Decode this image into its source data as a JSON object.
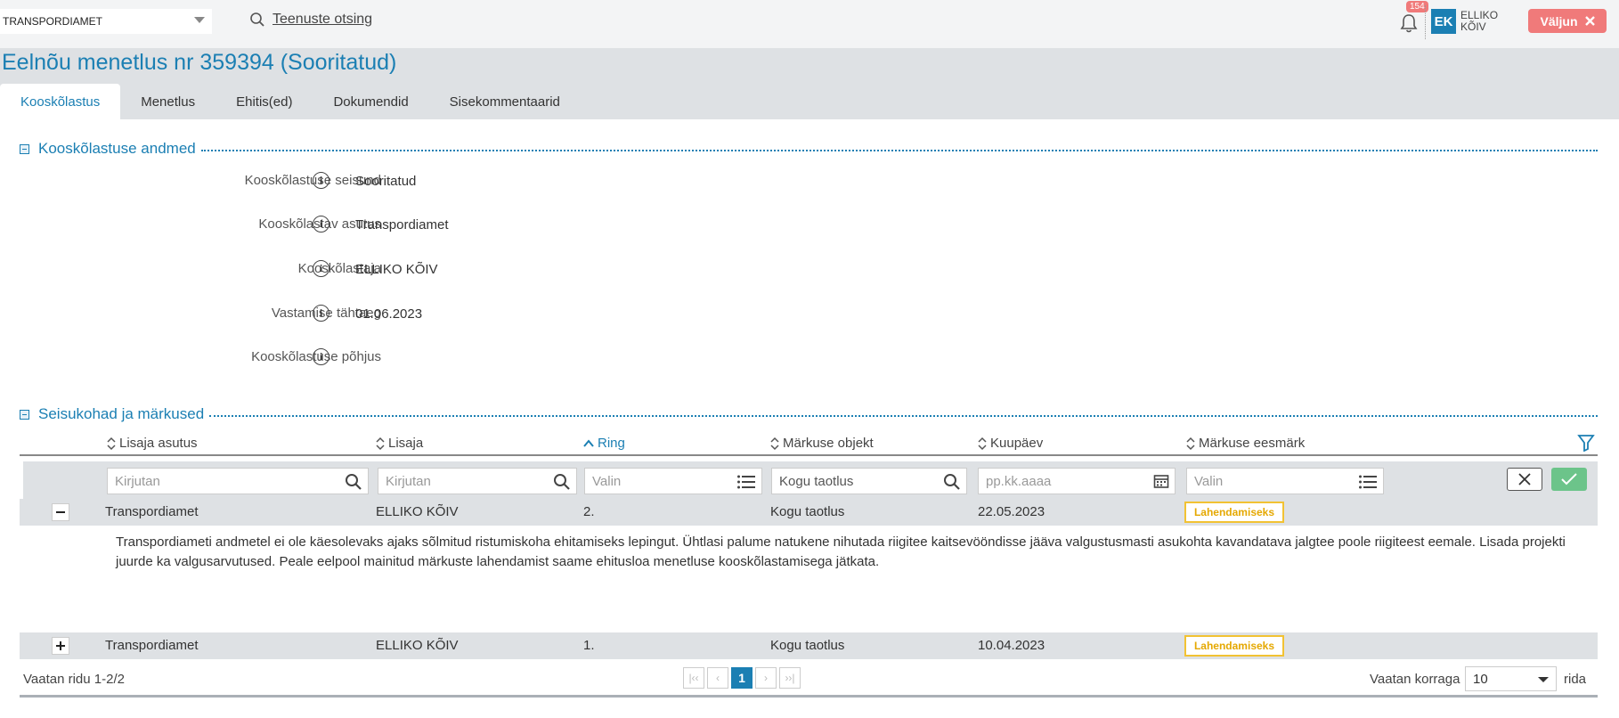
{
  "header": {
    "org": "TRANSPORDIAMET",
    "search_link": "Teenuste otsing",
    "notifications": "154",
    "avatar_initials": "EK",
    "user_first": "ELLIKO",
    "user_last": "KÕIV",
    "logout": "Väljun"
  },
  "page": {
    "title": "Eelnõu menetlus nr 359394 (Sooritatud)",
    "tabs": [
      "Kooskõlastus",
      "Menetlus",
      "Ehitis(ed)",
      "Dokumendid",
      "Sisekommentaarid"
    ],
    "active_tab": "Kooskõlastus"
  },
  "section1": {
    "title": "Kooskõlastuse andmed",
    "fields": [
      {
        "label": "Kooskõlastuse seisund",
        "value": "Sooritatud"
      },
      {
        "label": "Kooskõlastav asutus",
        "value": "Transpordiamet"
      },
      {
        "label": "Kooskõlastaja",
        "value": "ELLIKO KÕIV"
      },
      {
        "label": "Vastamise tähtaeg",
        "value": "01.06.2023"
      },
      {
        "label": "Kooskõlastuse põhjus",
        "value": ""
      }
    ]
  },
  "section2": {
    "title": "Seisukohad ja märkused",
    "columns": [
      "Lisaja asutus",
      "Lisaja",
      "Ring",
      "Märkuse objekt",
      "Kuupäev",
      "Märkuse eesmärk"
    ],
    "filters": [
      "Kirjutan",
      "Kirjutan",
      "Valin",
      "Kogu taotlus",
      "pp.kk.aaaa",
      "Valin"
    ],
    "rows": [
      {
        "toggle": "−",
        "asutus": "Transpordiamet",
        "lisaja": "ELLIKO KÕIV",
        "ring": "2.",
        "objekt": "Kogu taotlus",
        "kuupaev": "22.05.2023",
        "eesmark": "Lahendamiseks",
        "detail": "Transpordiameti andmetel ei ole käesolevaks ajaks sõlmitud ristumiskoha ehitamiseks lepingut. Ühtlasi palume natukene nihutada riigitee kaitsevööndisse jääva valgustusmasti asukohta kavandatava jalgtee poole riigiteest eemale. Lisada projekti juurde ka valgusarvutused. Peale eelpool mainitud märkuste lahendamist saame ehitusloa menetluse kooskõlastamisega jätkata."
      },
      {
        "toggle": "+",
        "asutus": "Transpordiamet",
        "lisaja": "ELLIKO KÕIV",
        "ring": "1.",
        "objekt": "Kogu taotlus",
        "kuupaev": "10.04.2023",
        "eesmark": "Lahendamiseks"
      }
    ]
  },
  "footer": {
    "rows_info": "Vaatan ridu 1-2/2",
    "current_page": "1",
    "per_page_label": "Vaatan korraga",
    "per_page": "10",
    "per_page_suffix": "rida"
  }
}
